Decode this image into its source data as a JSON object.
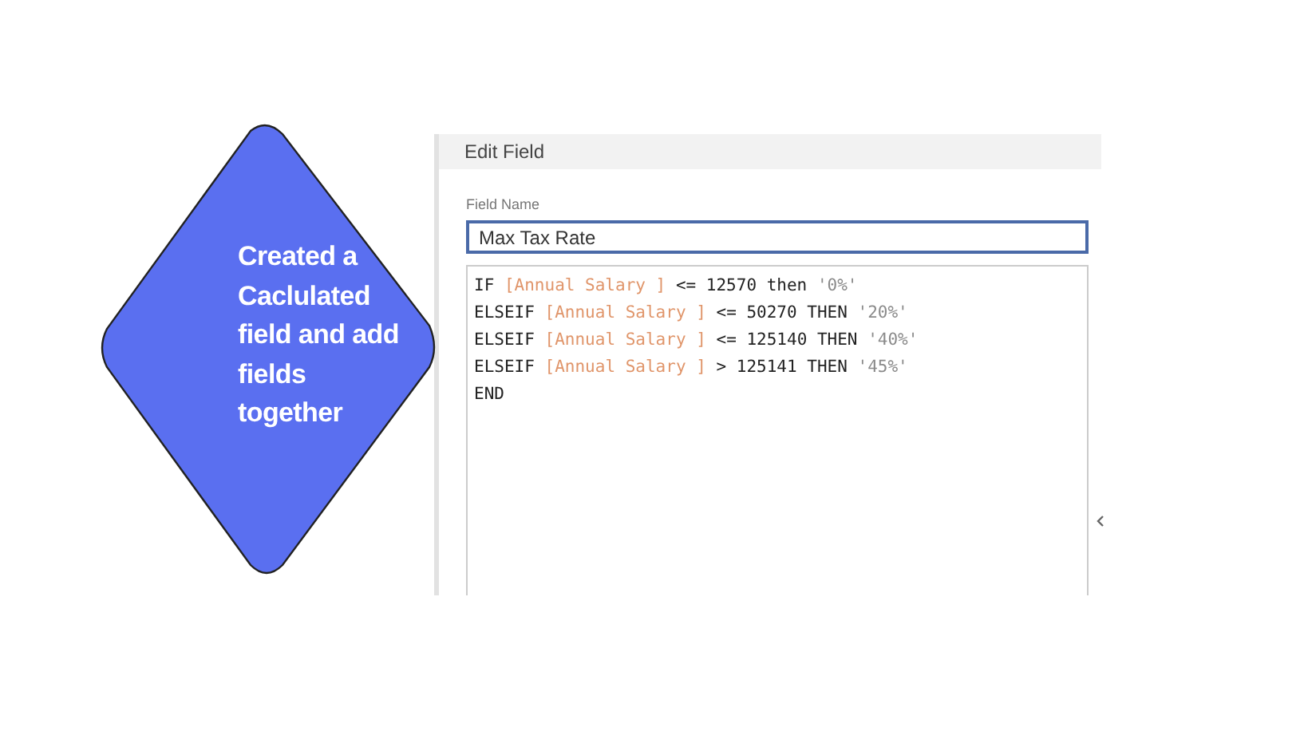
{
  "callout": {
    "text": "Created a Caclulated field and add fields together"
  },
  "dialog": {
    "title": "Edit Field",
    "field_name": {
      "label": "Field Name",
      "value": "Max Tax Rate"
    },
    "code_lines": [
      [
        {
          "kind": "keyword",
          "text": "IF "
        },
        {
          "kind": "field",
          "text": "[Annual Salary ]"
        },
        {
          "kind": "keyword",
          "text": " <= 12570 then "
        },
        {
          "kind": "string",
          "text": "'0%'"
        }
      ],
      [
        {
          "kind": "keyword",
          "text": "ELSEIF "
        },
        {
          "kind": "field",
          "text": "[Annual Salary ]"
        },
        {
          "kind": "keyword",
          "text": " <= 50270 THEN "
        },
        {
          "kind": "string",
          "text": "'20%'"
        }
      ],
      [
        {
          "kind": "keyword",
          "text": "ELSEIF "
        },
        {
          "kind": "field",
          "text": "[Annual Salary ]"
        },
        {
          "kind": "keyword",
          "text": " <= 125140 THEN "
        },
        {
          "kind": "string",
          "text": "'40%'"
        }
      ],
      [
        {
          "kind": "keyword",
          "text": "ELSEIF "
        },
        {
          "kind": "field",
          "text": "[Annual Salary ]"
        },
        {
          "kind": "keyword",
          "text": " > 125141 THEN "
        },
        {
          "kind": "string",
          "text": "'45%'"
        }
      ],
      [
        {
          "kind": "keyword",
          "text": "END"
        }
      ]
    ]
  }
}
